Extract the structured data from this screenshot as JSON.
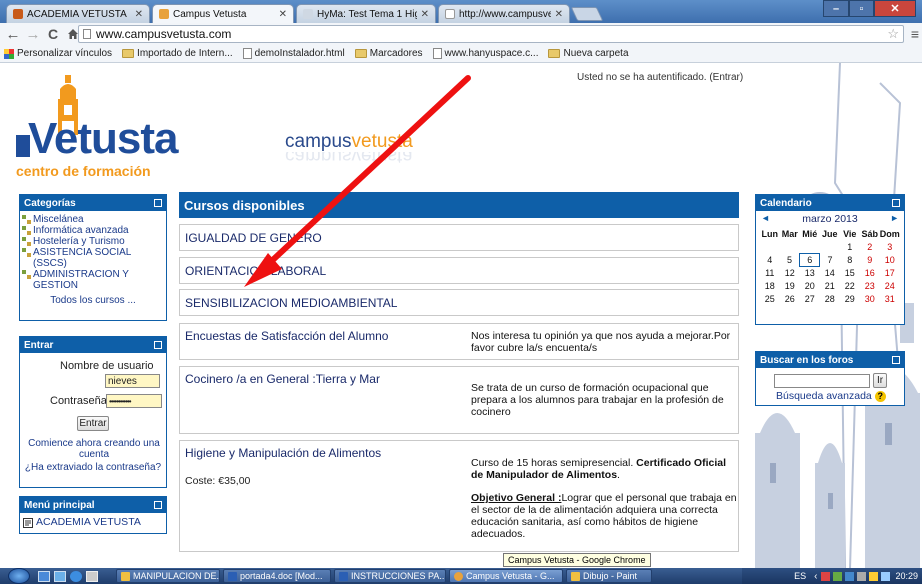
{
  "browser": {
    "tabs": [
      {
        "title": "ACADEMIA VETUSTA",
        "fav_color": "#c85a1a"
      },
      {
        "title": "Campus Vetusta",
        "fav_color": "#e8a23c"
      },
      {
        "title": "HyMa: Test Tema 1 Higien",
        "fav_color": "#cfd8e3"
      },
      {
        "title": "http://www.campusvetust",
        "fav_color": "#ffffff"
      }
    ],
    "url": "www.campusvetusta.com",
    "bookmarks": [
      {
        "label": "Personalizar vínculos",
        "icon": "apps-icon"
      },
      {
        "label": "Importado de Intern...",
        "icon": "folder-icon"
      },
      {
        "label": "demoInstalador.html",
        "icon": "page-icon"
      },
      {
        "label": "Marcadores",
        "icon": "folder-icon"
      },
      {
        "label": "www.hanyuspace.c...",
        "icon": "page-icon"
      },
      {
        "label": "Nueva carpeta",
        "icon": "folder-icon"
      }
    ],
    "window_buttons": [
      "–",
      "▫",
      "✕"
    ]
  },
  "site": {
    "login_status": "Usted no se ha autentificado.",
    "login_link": "(Entrar)",
    "logo_name": "Vetusta",
    "logo_sub": "centro de formación",
    "campus_text_a": "campus",
    "campus_text_b": "vetusta",
    "categories": {
      "title": "Categorías",
      "items": [
        "Miscelánea",
        "Informática avanzada",
        "Hostelería y Turismo",
        "ASISTENCIA SOCIAL (SSCS)",
        "ADMINISTRACION Y GESTION"
      ],
      "all": "Todos los cursos ..."
    },
    "login": {
      "title": "Entrar",
      "user_label": "Nombre de usuario",
      "user_value": "nieves",
      "pass_label": "Contraseña",
      "pass_value": "••••••••••••",
      "button": "Entrar",
      "signup": "Comience ahora creando una cuenta",
      "forgot": "¿Ha extraviado la contraseña?"
    },
    "menu": {
      "title": "Menú principal",
      "item": "ACADEMIA VETUSTA"
    },
    "courses": {
      "title": "Cursos disponibles",
      "list": [
        {
          "name": "IGUALDAD DE GENERO"
        },
        {
          "name": "ORIENTACION LABORAL"
        },
        {
          "name": "SENSIBILIZACION MEDIOAMBIENTAL"
        },
        {
          "name": "Encuestas de Satisfacción del Alumno",
          "desc": "Nos interesa tu opinión ya que nos ayuda a mejorar.Por favor cubre la/s encuenta/s"
        },
        {
          "name": "Cocinero /a en General :Tierra y Mar",
          "desc": "Se trata de un curso de formación ocupacional que prepara a los alumnos para trabajar en la profesión de cocinero"
        },
        {
          "name": "Higiene y Manipulación de Alimentos",
          "cost": "Coste: €35,00",
          "desc_a": "Curso de 15 horas semipresencial.",
          "desc_b": "Certificado Oficial de Manipulador de Alimentos",
          "desc_c": ".",
          "obj_label": "Objetivo General :",
          "obj_text": "Lograr que el personal que trabaja en el sector de la de alimentación adquiera una correcta educación sanitaria, así como hábitos de higiene adecuados."
        }
      ]
    },
    "calendar": {
      "title": "Calendario",
      "month": "marzo 2013",
      "prev": "◄",
      "next": "►",
      "days": [
        "Lun",
        "Mar",
        "Mié",
        "Jue",
        "Vie",
        "Sáb",
        "Dom"
      ],
      "weeks": [
        [
          "",
          "",
          "",
          "",
          "1",
          "2",
          "3"
        ],
        [
          "4",
          "5",
          "6",
          "7",
          "8",
          "9",
          "10"
        ],
        [
          "11",
          "12",
          "13",
          "14",
          "15",
          "16",
          "17"
        ],
        [
          "18",
          "19",
          "20",
          "21",
          "22",
          "23",
          "24"
        ],
        [
          "25",
          "26",
          "27",
          "28",
          "29",
          "30",
          "31"
        ]
      ],
      "today": "6"
    },
    "forum_search": {
      "title": "Buscar en los foros",
      "button": "Ir",
      "advanced": "Búsqueda avanzada"
    }
  },
  "tooltip": "Campus Vetusta - Google Chrome",
  "taskbar": {
    "items": [
      {
        "label": "MANIPULACION DE...",
        "color": "#f0c040"
      },
      {
        "label": "portada4.doc [Mod...",
        "color": "#2b5fb4"
      },
      {
        "label": "INSTRUCCIONES PA...",
        "color": "#2b5fb4"
      },
      {
        "label": "Campus Vetusta - G...",
        "color": "#e8a23c"
      },
      {
        "label": "Dibujo - Paint",
        "color": "#f0c040"
      }
    ],
    "lang": "ES",
    "time": "20:29"
  },
  "colors": {
    "accent": "#0e5fa8",
    "arrow": "#e11"
  }
}
